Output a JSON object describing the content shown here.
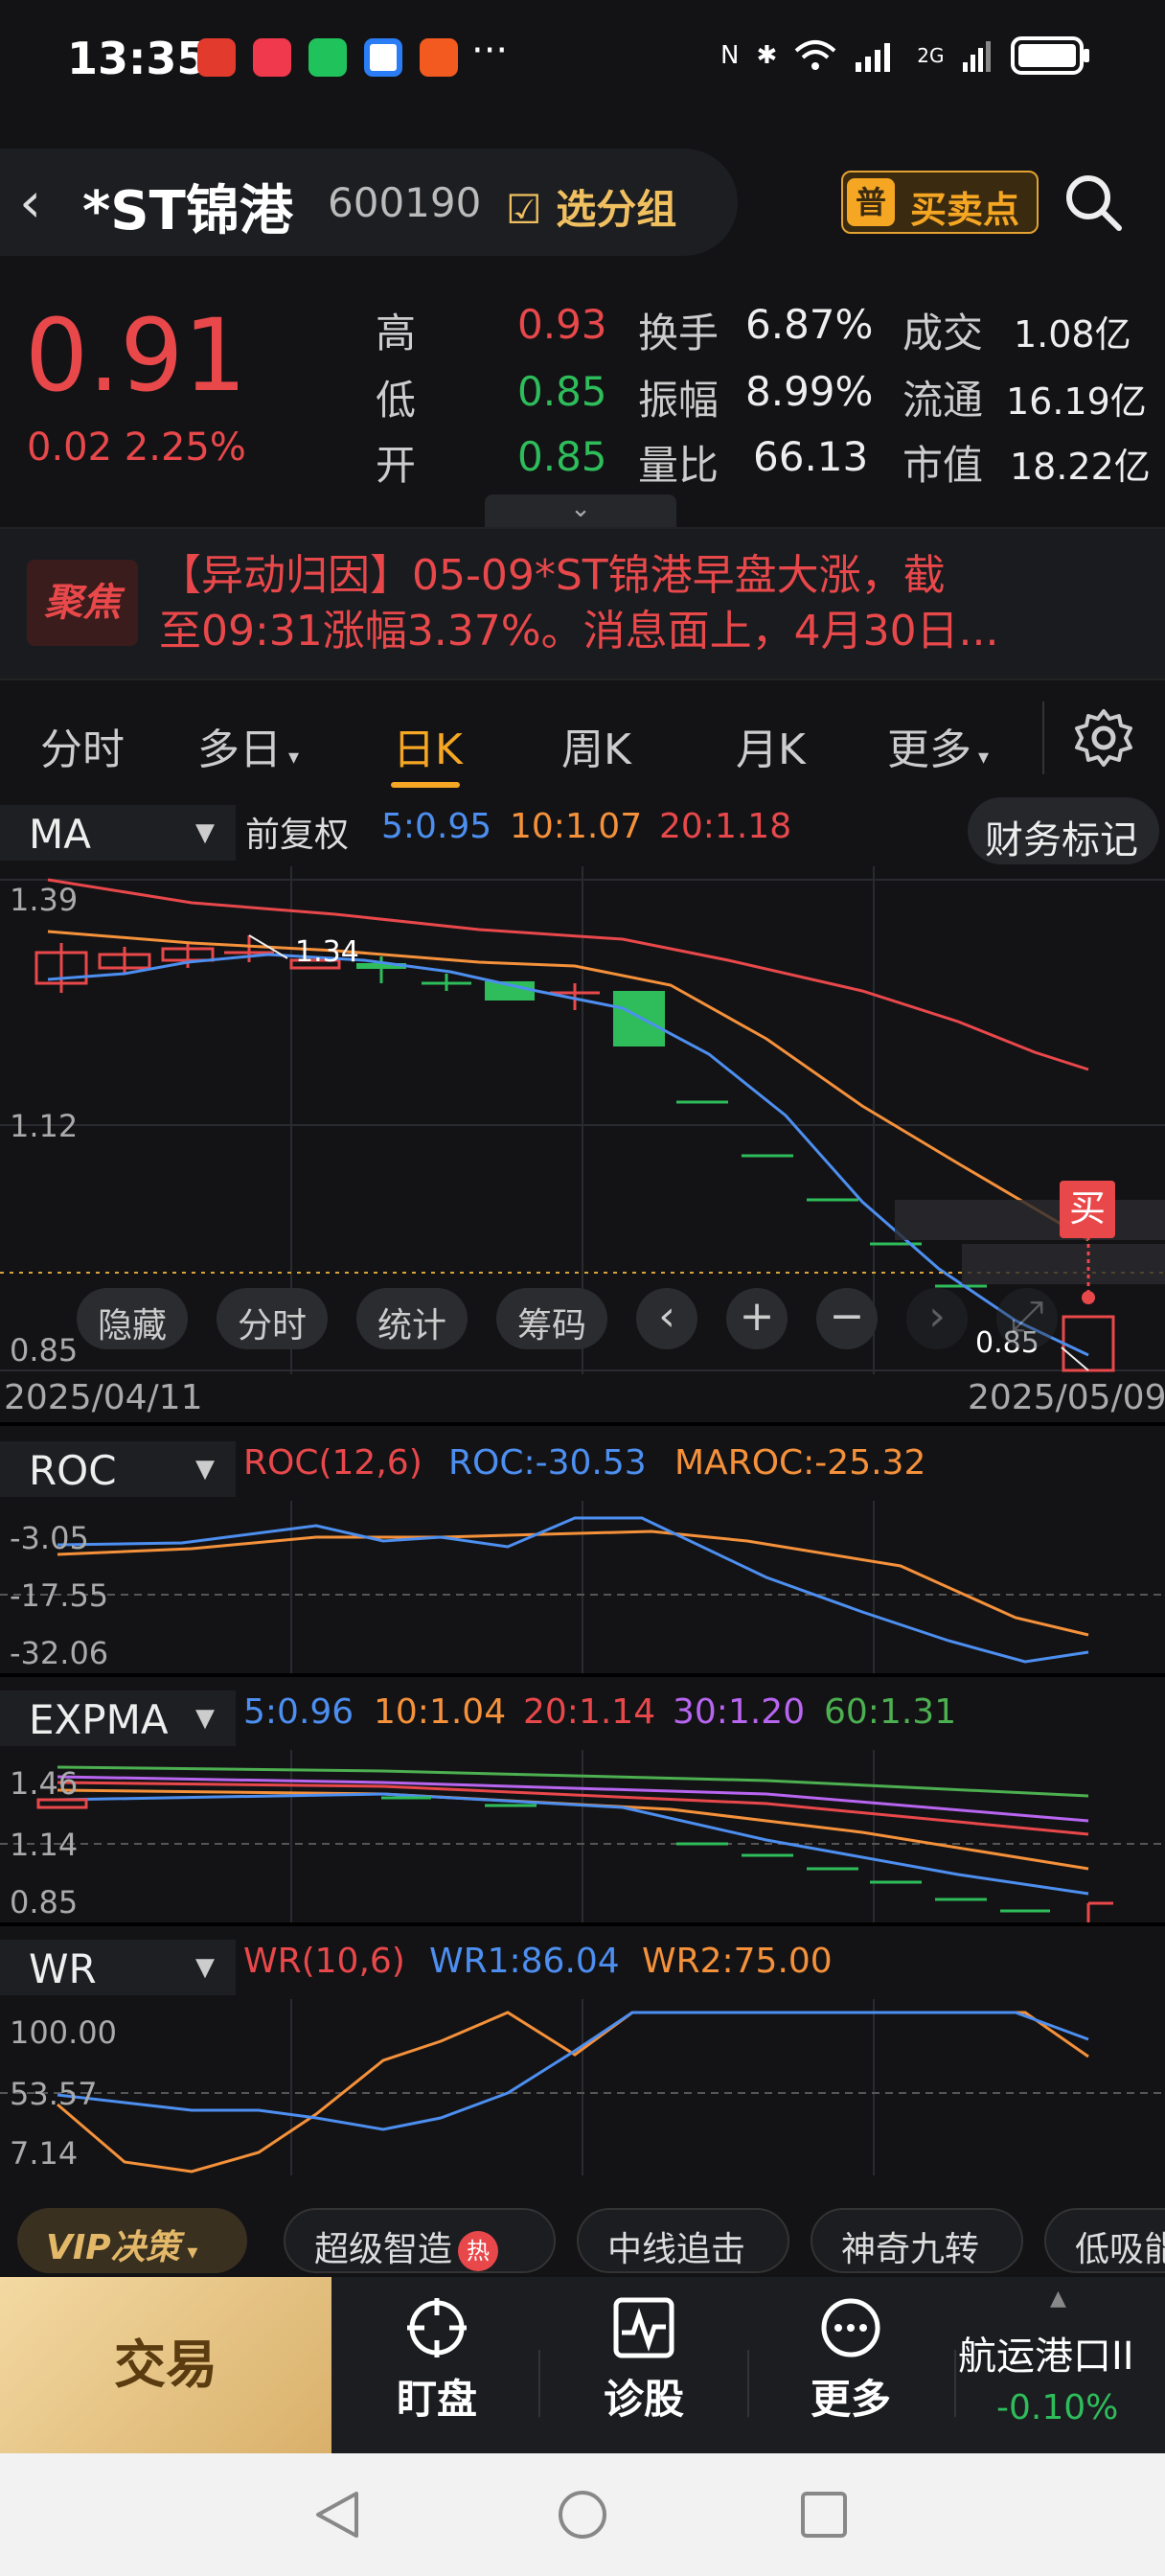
{
  "status_bar": {
    "time": "13:35",
    "dots": "···",
    "network": "2G"
  },
  "header": {
    "back_icon": "back-arrow-icon",
    "stock_name": "*ST锦港",
    "stock_code": "600190",
    "group_label": "选分组",
    "buy_sell_label": "买卖点",
    "buy_sell_icon_text": "普"
  },
  "quote": {
    "price": "0.91",
    "change": "0.02",
    "change_pct": "2.25%",
    "rows": [
      {
        "l1": "高",
        "v1": "0.93",
        "c1": "red",
        "l2": "换手",
        "v2": "6.87%",
        "l3": "成交",
        "v3": "1.08亿"
      },
      {
        "l1": "低",
        "v1": "0.85",
        "c1": "green",
        "l2": "振幅",
        "v2": "8.99%",
        "l3": "流通",
        "v3": "16.19亿"
      },
      {
        "l1": "开",
        "v1": "0.85",
        "c1": "green",
        "l2": "量比",
        "v2": "66.13",
        "l3": "市值",
        "v3": "18.22亿"
      }
    ]
  },
  "news": {
    "badge": "聚焦",
    "line1": "【异动归因】05-09*ST锦港早盘大涨，截",
    "line2": "至09:31涨幅3.37%。消息面上，4月30日..."
  },
  "tabs": [
    "分时",
    "多日",
    "日K",
    "周K",
    "月K",
    "更多"
  ],
  "main_chart": {
    "indicator": "MA",
    "adjust": "前复权",
    "ma_labels": [
      "5:0.95",
      "10:1.07",
      "20:1.18"
    ],
    "ma_colors": [
      "#4d8ff0",
      "#f5913a",
      "#e9484b"
    ],
    "finance_btn": "财务标记",
    "y_top": "1.39",
    "y_mid": "1.12",
    "y_bottom": "0.85",
    "peak_label": "1.34",
    "low_label": "0.85",
    "date_start": "2025/04/11",
    "date_end": "2025/05/09",
    "buy_tag": "买",
    "toolbar": [
      "隐藏",
      "分时",
      "统计",
      "筹码"
    ]
  },
  "roc": {
    "indicator": "ROC",
    "params": "ROC(12,6)",
    "roc": "ROC:-30.53",
    "maroc": "MAROC:-25.32",
    "y": [
      "-3.05",
      "-17.55",
      "-32.06"
    ]
  },
  "expma": {
    "indicator": "EXPMA",
    "labels": [
      "5:0.96",
      "10:1.04",
      "20:1.14",
      "30:1.20",
      "60:1.31"
    ],
    "colors": [
      "#4d8ff0",
      "#f5913a",
      "#e9484b",
      "#b865f0",
      "#4caf50"
    ],
    "y": [
      "1.46",
      "1.14",
      "0.85"
    ]
  },
  "wr": {
    "indicator": "WR",
    "params": "WR(10,6)",
    "wr1": "WR1:86.04",
    "wr2": "WR2:75.00",
    "y": [
      "100.00",
      "53.57",
      "7.14"
    ]
  },
  "strategies": {
    "vip": "VIP决策",
    "chips": [
      "超级智造",
      "中线追击",
      "神奇九转",
      "低吸能"
    ],
    "hot": "热"
  },
  "bottom_nav": {
    "trade": "交易",
    "items": [
      "盯盘",
      "诊股",
      "更多"
    ],
    "sector": "航运港口II",
    "sector_pct": "-0.10%"
  }
}
